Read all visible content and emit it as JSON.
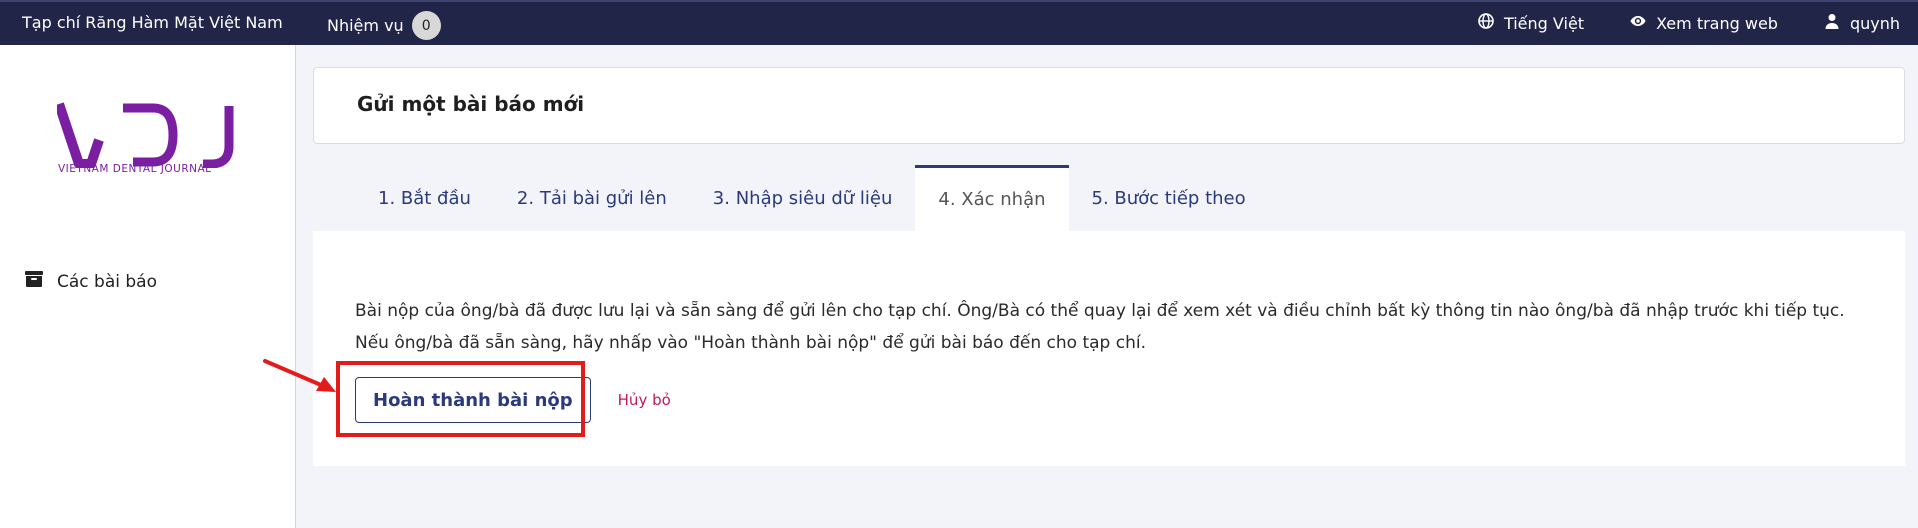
{
  "topbar": {
    "site_name": "Tạp chí Răng Hàm Mặt Việt Nam",
    "tasks_label": "Nhiệm vụ",
    "tasks_count": "0",
    "language": "Tiếng Việt",
    "view_site": "Xem trang web",
    "user": "quynh",
    "icons": [
      "globe-icon",
      "eye-icon",
      "user-icon"
    ]
  },
  "sidebar": {
    "logo_text": "VDJ",
    "logo_subtitle": "VIETNAM DENTAL JOURNAL",
    "items": [
      {
        "label": "Các bài báo",
        "icon": "archive-icon"
      }
    ]
  },
  "page": {
    "title": "Gửi một bài báo mới"
  },
  "tabs": [
    {
      "label": "1. Bắt đầu",
      "active": false
    },
    {
      "label": "2. Tải bài gửi lên",
      "active": false
    },
    {
      "label": "3. Nhập siêu dữ liệu",
      "active": false
    },
    {
      "label": "4. Xác nhận",
      "active": true
    },
    {
      "label": "5. Bước tiếp theo",
      "active": false
    }
  ],
  "confirm": {
    "message": "Bài nộp của ông/bà đã được lưu lại và sẵn sàng để gửi lên cho tạp chí. Ông/Bà có thể quay lại để xem xét và điều chỉnh bất kỳ thông tin nào ông/bà đã nhập trước khi tiếp tục. Nếu ông/bà đã sẵn sàng, hãy nhấp vào \"Hoàn thành bài nộp\" để gửi bài báo đến cho tạp chí.",
    "finish_label": "Hoàn thành bài nộp",
    "cancel_label": "Hủy bỏ"
  },
  "colors": {
    "topbar_bg": "#212648",
    "accent": "#2b3a7a",
    "logo": "#7b1fa2",
    "cancel": "#c2185b",
    "highlight": "#e31b1b"
  }
}
